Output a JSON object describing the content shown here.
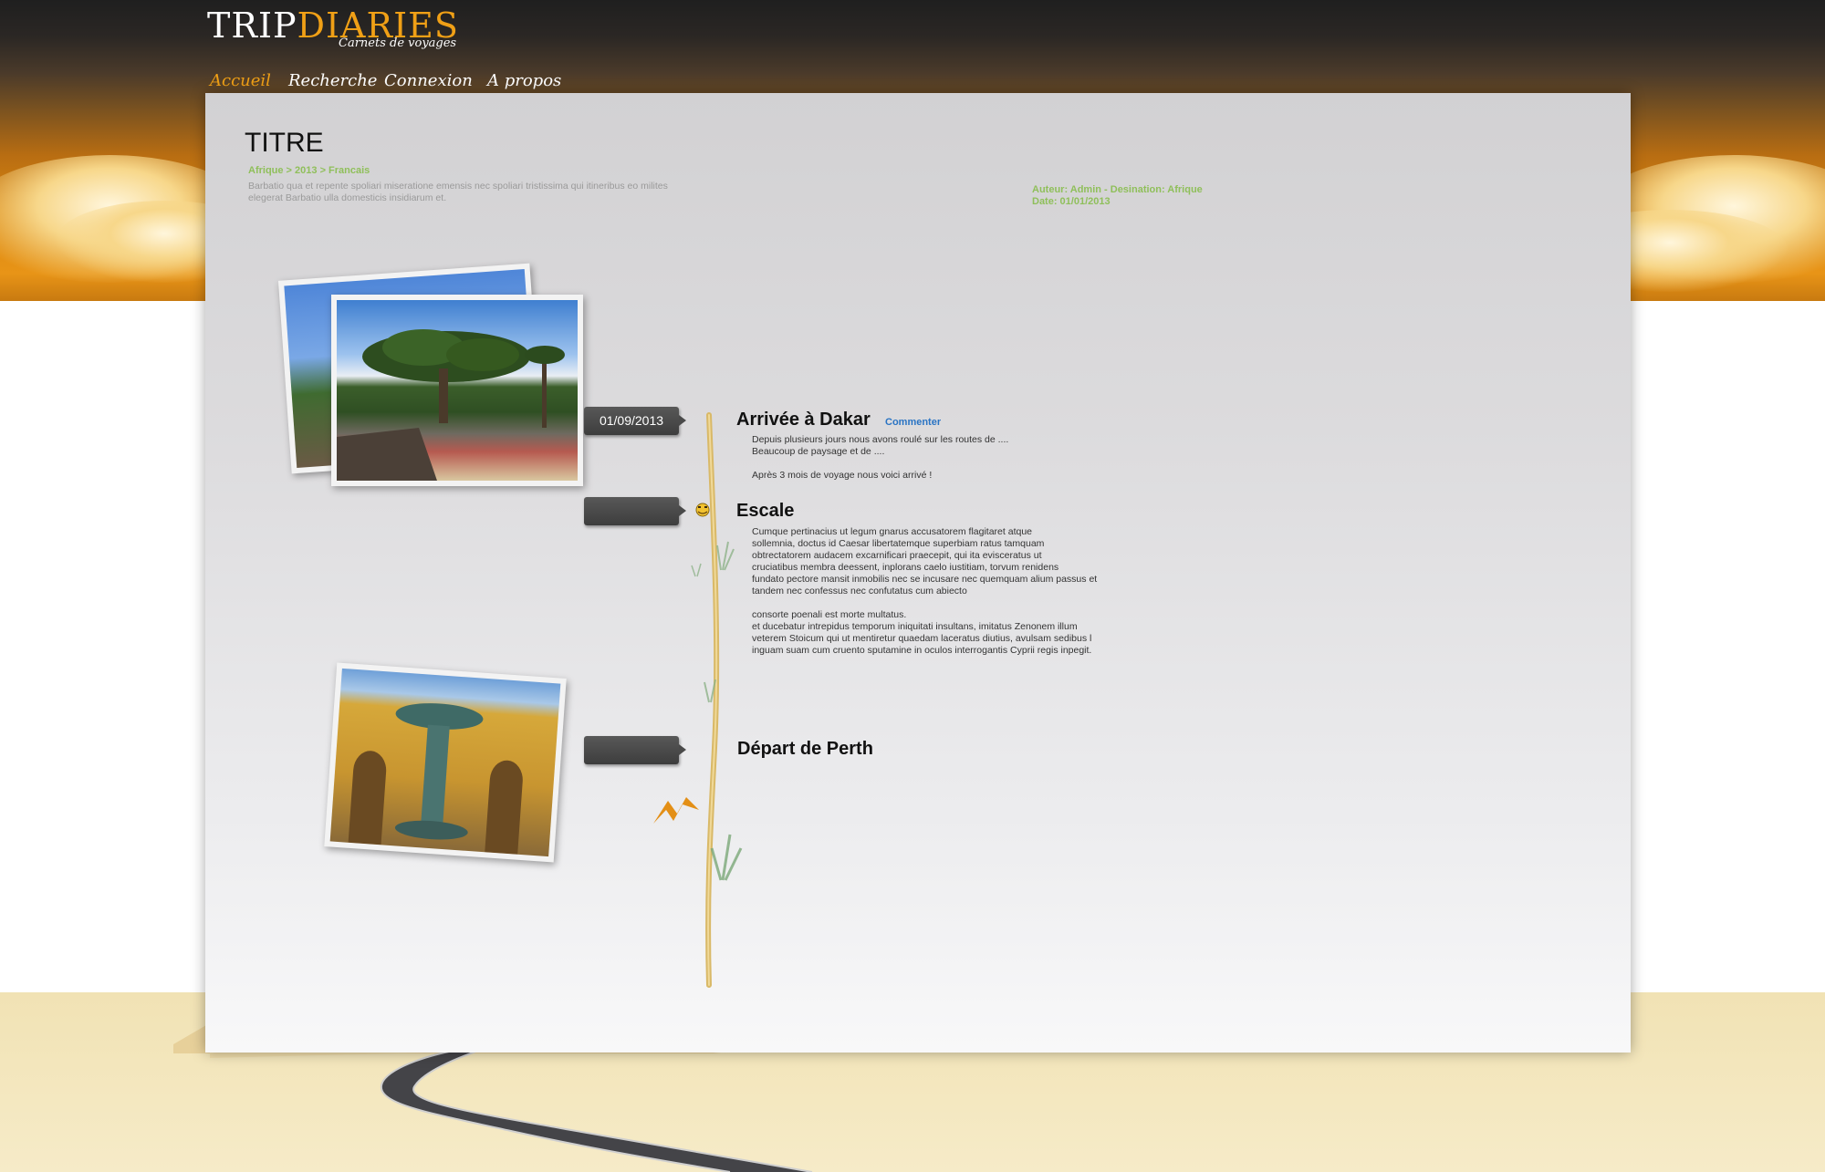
{
  "header": {
    "logo_trip": "TRIP",
    "logo_diaries": "DIARIES",
    "tagline": "Carnets de voyages"
  },
  "nav": {
    "items": [
      {
        "label": "Accueil",
        "active": true
      },
      {
        "label": "Recherche",
        "active": false
      },
      {
        "label": "Connexion",
        "active": false
      },
      {
        "label": "A propos",
        "active": false
      }
    ]
  },
  "page": {
    "title": "TITRE",
    "breadcrumb": "Afrique > 2013 > Francais",
    "intro": "Barbatio qua et repente spoliari miseratione emensis nec spoliari tristissima qui itineribus eo milites elegerat Barbatio ulla domesticis insidiarum et.",
    "meta_line1": "Auteur: Admin - Desination: Afrique",
    "meta_line2": "Date: 01/01/2013"
  },
  "timeline": {
    "entries": [
      {
        "date": "01/09/2013",
        "title": "Arrivée à Dakar",
        "comment_label": "Commenter",
        "text": "Depuis plusieurs jours nous avons roulé sur les routes de ....\nBeaucoup de paysage et de ....\n\nAprès 3 mois de voyage nous voici arrivé !"
      },
      {
        "date": "",
        "title": "Escale",
        "text": "Cumque pertinacius ut legum gnarus accusatorem flagitaret atque\nsollemnia, doctus id Caesar libertatemque superbiam ratus tamquam\nobtrectatorem audacem excarnificari praecepit, qui ita evisceratus ut\ncruciatibus membra deessent, inplorans caelo iustitiam, torvum renidens\n fundato pectore mansit inmobilis nec se incusare nec quemquam alium passus et\ntandem nec confessus nec confutatus cum abiecto\n\nconsorte poenali est morte multatus.\net ducebatur intrepidus temporum iniquitati insultans, imitatus Zenonem illum\nveterem Stoicum qui ut mentiretur quaedam laceratus diutius, avulsam sedibus l\ninguam suam cum cruento sputamine in oculos interrogantis Cyprii regis inpegit."
      },
      {
        "date": "",
        "title": "Départ de Perth"
      }
    ]
  },
  "colors": {
    "accent": "#f0a016",
    "meta_green": "#8fbf5a",
    "link_blue": "#2a74c4",
    "tag_dark": "#454545"
  },
  "icons": [
    "emoticon-icon",
    "mountain-icon",
    "grass-icon"
  ]
}
